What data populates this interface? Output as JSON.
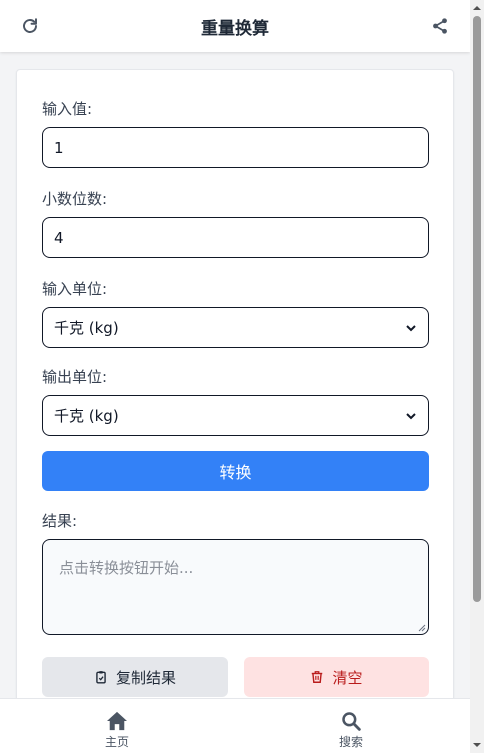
{
  "header": {
    "title": "重量换算",
    "refresh_icon": "refresh-icon",
    "share_icon": "share-icon"
  },
  "form": {
    "input_value": {
      "label": "输入值:",
      "value": "1"
    },
    "decimals": {
      "label": "小数位数:",
      "value": "4"
    },
    "input_unit": {
      "label": "输入单位:",
      "selected": "千克 (kg)"
    },
    "output_unit": {
      "label": "输出单位:",
      "selected": "千克 (kg)"
    },
    "convert_label": "转换",
    "result": {
      "label": "结果:",
      "placeholder": "点击转换按钮开始..."
    },
    "copy_label": "复制结果",
    "clear_label": "清空"
  },
  "bottom_nav": {
    "items": [
      {
        "label": "主页",
        "icon": "home-icon"
      },
      {
        "label": "搜索",
        "icon": "search-icon"
      }
    ]
  },
  "colors": {
    "primary": "#3381f7",
    "danger_bg": "#fee2e2",
    "danger_text": "#b91c1c",
    "neutral_bg": "#e5e7eb"
  }
}
